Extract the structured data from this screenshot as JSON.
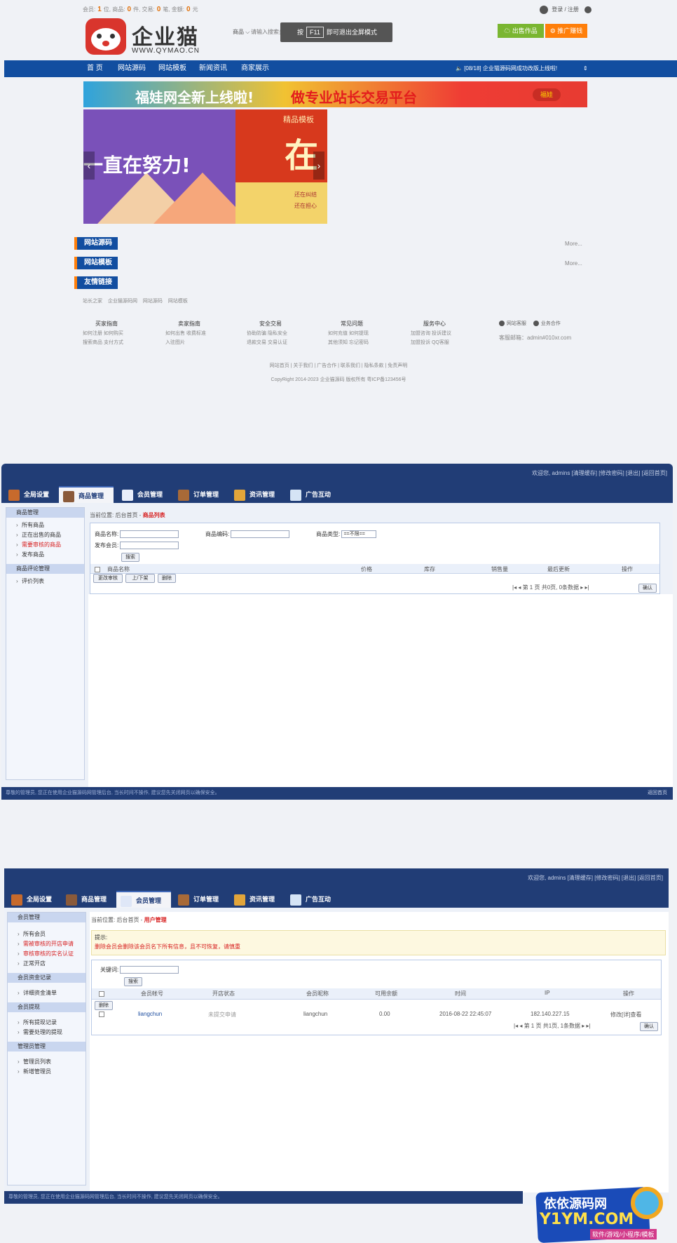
{
  "site": {
    "stats_prefix": "会员:",
    "stats": [
      {
        "label": "会员:",
        "value": "1",
        "unit": "位,"
      },
      {
        "label": "商品:",
        "value": "0",
        "unit": "件,"
      },
      {
        "label": "交易:",
        "value": "0",
        "unit": "笔,"
      },
      {
        "label": "金额:",
        "value": "0",
        "unit": "元"
      }
    ],
    "login": "登录",
    "register": "注册",
    "logo_text": "企业猫",
    "logo_url": "WWW.QYMAO.CN",
    "search_select": "商品",
    "search_placeholder": "请输入搜索关键",
    "f11_prefix": "按",
    "f11_key": "F11",
    "f11_suffix": "即可退出全屏模式",
    "sell_button": "出售作品",
    "ad_button": "推广赚钱",
    "nav": [
      "首 页",
      "网站源码",
      "网站模板",
      "新闻资讯",
      "商家展示"
    ],
    "notice": "[08/18] 企业猫源码网成功改版上线啦!",
    "banner_text1": "福娃网全新上线啦!",
    "banner_text2": "做专业站长交易平台",
    "banner_tag": "福娃",
    "slide_text": "一直在努力!",
    "slide_small": "精品模板",
    "slide_big": "在",
    "slide_line1": "还在纠结",
    "slide_line2": "还在担心",
    "sections": [
      {
        "title": "网站源码",
        "more": "More..."
      },
      {
        "title": "网站模板",
        "more": "More..."
      },
      {
        "title": "友情链接",
        "more": ""
      }
    ],
    "friend_links": "站长之家 企业猫源码网 网站源码 网站模板",
    "footer_cols": [
      {
        "head": "买家指南",
        "rows": [
          "如何注册 如何购买",
          "搜索商品 支付方式"
        ]
      },
      {
        "head": "卖家指南",
        "rows": [
          "如何出售 收费标准",
          "入驻图片"
        ]
      },
      {
        "head": "安全交易",
        "rows": [
          "协助防骗 隐私安全",
          "退款交易 交易认证"
        ]
      },
      {
        "head": "常见问题",
        "rows": [
          "如何充值 如何提现",
          "其他须知 忘记密码"
        ]
      },
      {
        "head": "服务中心",
        "rows": [
          "加盟咨询 投诉建议",
          "加盟投诉 QQ客服"
        ]
      }
    ],
    "contact_qq1": "网站客服",
    "contact_qq2": "业务合作",
    "email": "客服邮箱：admin#010xr.com",
    "footer_links": "网站首页 | 关于我们 | 广告合作 | 联系我们 | 隐私条款 | 免责声明",
    "copyright": "CopyRight 2014-2023 企业猫源码 版权所有 粤ICP备123456号"
  },
  "admin1": {
    "header_links": "欢迎您, admins [清理缓存] [修改密码] [退出] [返回首页]",
    "tabs": [
      "全局设置",
      "商品管理",
      "会员管理",
      "订单管理",
      "资讯管理",
      "广告互动"
    ],
    "active_tab": "商品管理",
    "side_groups": [
      {
        "title": "商品管理",
        "items": [
          {
            "label": "所有商品",
            "red": false
          },
          {
            "label": "正在出售的商品",
            "red": false
          },
          {
            "label": "需要审核的商品",
            "red": true
          },
          {
            "label": "发布商品",
            "red": false
          }
        ]
      },
      {
        "title": "商品评论管理",
        "items": [
          {
            "label": "评价列表",
            "red": false
          }
        ]
      }
    ],
    "crumb_prefix": "当前位置: 后台首页 -",
    "crumb_current": "商品列表",
    "filters": {
      "name": "商品名称:",
      "code": "商品编码:",
      "type": "商品类型:",
      "type_value": "==不限==",
      "seller": "发布会员:",
      "search": "搜索"
    },
    "columns": [
      "商品名称",
      "价格",
      "库存",
      "销售量",
      "最后更新",
      "操作"
    ],
    "actions": [
      "更改审核",
      "上/下架",
      "删除"
    ],
    "pager": "第 1 页 共0页, 0条数据",
    "pager_button": "确认",
    "footer": "尊敬的管理员, 您正在使用企业猫源码网管理后台, 当长时间不操作, 建议您先关闭网页以确保安全。",
    "footer_right": "返回首页"
  },
  "admin2": {
    "header_links": "欢迎您, admins [清理缓存] [修改密码] [退出] [返回首页]",
    "tabs": [
      "全局设置",
      "商品管理",
      "会员管理",
      "订单管理",
      "资讯管理",
      "广告互动"
    ],
    "active_tab": "会员管理",
    "side_groups": [
      {
        "title": "会员管理",
        "items": [
          {
            "label": "所有会员",
            "red": false
          },
          {
            "label": "需被审核的开店申请",
            "red": true
          },
          {
            "label": "审核审核的实名认证",
            "red": true
          },
          {
            "label": "正常开店",
            "red": false
          }
        ]
      },
      {
        "title": "会员资金记录",
        "items": [
          {
            "label": "详细资金清单",
            "red": false
          }
        ]
      },
      {
        "title": "会员提现",
        "items": [
          {
            "label": "所有提现记录",
            "red": false
          },
          {
            "label": "需要处理的提现",
            "red": false
          }
        ]
      },
      {
        "title": "管理员管理",
        "items": [
          {
            "label": "管理员列表",
            "red": false
          },
          {
            "label": "新增管理员",
            "red": false
          }
        ]
      }
    ],
    "crumb_prefix": "当前位置: 后台首页 -",
    "crumb_current": "用户管理",
    "tip_title": "提示:",
    "tip_text": "删除会员会删除该会员名下所有信息，且不可恢复，请慎重",
    "keyword_label": "关键词:",
    "search": "搜索",
    "columns": [
      "会员帐号",
      "开店状态",
      "会员昵称",
      "可用余额",
      "时间",
      "IP",
      "操作"
    ],
    "delete": "删除",
    "row": {
      "account": "liangchun",
      "status": "未提交申请",
      "nick": "liangchun",
      "balance": "0.00",
      "time": "2016-08-22 22:45:07",
      "ip": "182.140.227.15",
      "op": "修改[详]查看"
    },
    "pager": "第 1 页 共1页, 1条数据",
    "pager_button": "确认",
    "footer": "尊敬的管理员, 您正在使用企业猫源码网管理后台, 当长时间不操作, 建议您先关闭网页以确保安全。"
  },
  "watermark": {
    "line1": "依依源码网",
    "line2": "Y1YM.COM",
    "line3": "软件/游戏/小程序/模板"
  }
}
